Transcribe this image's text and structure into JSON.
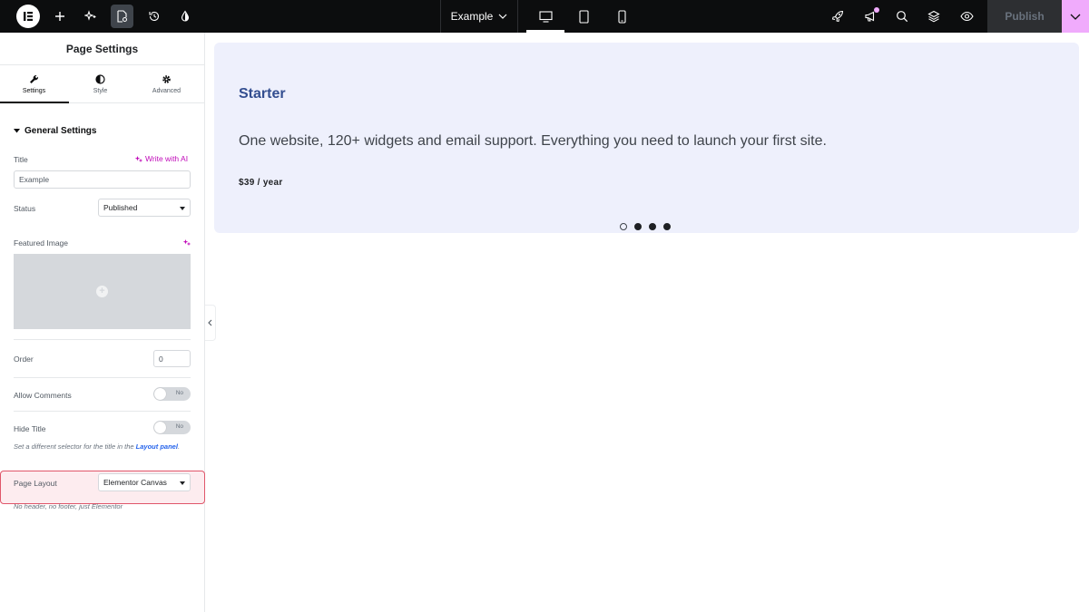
{
  "topbar": {
    "document_title": "Example",
    "publish_label": "Publish",
    "colors": {
      "background": "#0c0d0e",
      "accent": "#f0abfc"
    }
  },
  "panel": {
    "header_title": "Page Settings",
    "tabs": [
      {
        "label": "Settings",
        "icon": "wrench-icon",
        "active": true
      },
      {
        "label": "Style",
        "icon": "half-circle-icon",
        "active": false
      },
      {
        "label": "Advanced",
        "icon": "gear-icon",
        "active": false
      }
    ],
    "section_title": "General Settings",
    "title_field": {
      "label": "Title",
      "value": "Example",
      "ai_link": "Write with AI"
    },
    "status_field": {
      "label": "Status",
      "value": "Published"
    },
    "featured_image": {
      "label": "Featured Image"
    },
    "order_field": {
      "label": "Order",
      "value": "0"
    },
    "allow_comments": {
      "label": "Allow Comments",
      "state": "No"
    },
    "hide_title": {
      "label": "Hide Title",
      "state": "No",
      "help_prefix": "Set a different selector for the title in the",
      "help_link": "Layout panel",
      "help_suffix": "."
    },
    "page_layout": {
      "label": "Page Layout",
      "value": "Elementor Canvas",
      "help": "No header, no footer, just Elementor"
    }
  },
  "canvas": {
    "heading": "Starter",
    "description": "One website, 120+ widgets and email support. Everything you need to launch your first site.",
    "price": "$39 / year",
    "slides_total": 4,
    "slide_current": 1,
    "colors": {
      "card_background": "#eef0fc",
      "heading": "#334e90"
    }
  }
}
